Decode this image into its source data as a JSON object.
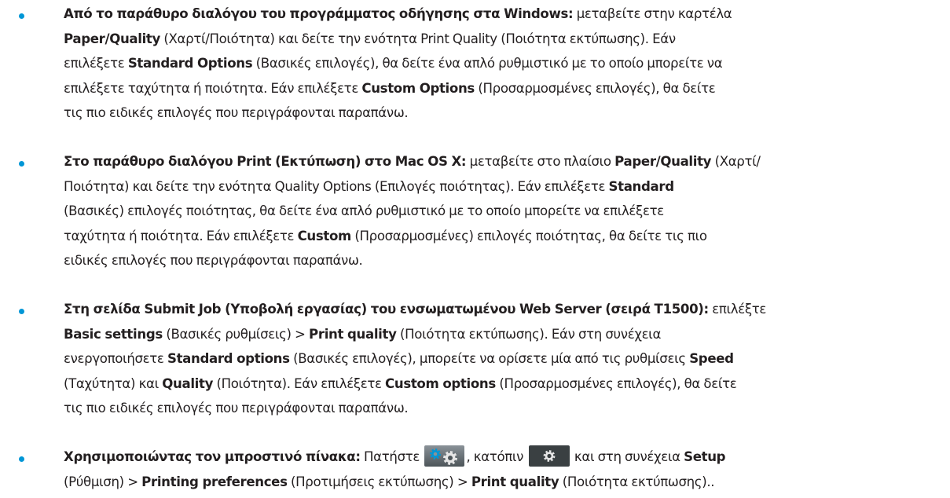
{
  "bullet_color": "#0096d6",
  "button_colors": {
    "settings_bg_top": "#8a9298",
    "settings_bg_bottom": "#4d5559",
    "setup_bg": "#3a4042",
    "icon_blue": "#0096d6",
    "icon_light": "#e6e6e6"
  },
  "icons": [
    "settings-gears-icon",
    "setup-gear-icon"
  ],
  "bullets": [
    {
      "lines": [
        [
          {
            "t": "Από το παράθυρο διαλόγου του προγράμματος οδήγησης στα Windows:",
            "b": true
          },
          {
            "t": " μεταβείτε στην καρτέλα"
          }
        ],
        [
          {
            "t": "Paper/Quality",
            "b": true
          },
          {
            "t": " (Χαρτί/Ποιότητα) και δείτε την ενότητα Print Quality (Ποιότητα εκτύπωσης). Εάν"
          }
        ],
        [
          {
            "t": "επιλέξετε "
          },
          {
            "t": "Standard Options",
            "b": true
          },
          {
            "t": " (Βασικές επιλογές), θα δείτε ένα απλό ρυθμιστικό με το οποίο μπορείτε να"
          }
        ],
        [
          {
            "t": "επιλέξετε ταχύτητα ή ποιότητα. Εάν επιλέξετε "
          },
          {
            "t": "Custom Options",
            "b": true
          },
          {
            "t": " (Προσαρμοσμένες επιλογές), θα δείτε"
          }
        ],
        [
          {
            "t": "τις πιο ειδικές επιλογές που περιγράφονται παραπάνω."
          }
        ]
      ]
    },
    {
      "lines": [
        [
          {
            "t": "Στο παράθυρο διαλόγου Print (Εκτύπωση) στο Mac OS X:",
            "b": true
          },
          {
            "t": " μεταβείτε στο πλαίσιο "
          },
          {
            "t": "Paper/Quality",
            "b": true
          },
          {
            "t": " (Χαρτί/"
          }
        ],
        [
          {
            "t": "Ποιότητα) και δείτε την ενότητα Quality Options (Επιλογές ποιότητας). Εάν επιλέξετε "
          },
          {
            "t": "Standard",
            "b": true
          }
        ],
        [
          {
            "t": "(Βασικές) επιλογές ποιότητας, θα δείτε ένα απλό ρυθμιστικό με το οποίο μπορείτε να επιλέξετε"
          }
        ],
        [
          {
            "t": "ταχύτητα ή ποιότητα. Εάν επιλέξετε "
          },
          {
            "t": "Custom",
            "b": true
          },
          {
            "t": " (Προσαρμοσμένες) επιλογές ποιότητας, θα δείτε τις πιο"
          }
        ],
        [
          {
            "t": "ειδικές επιλογές που περιγράφονται παραπάνω."
          }
        ]
      ]
    },
    {
      "lines": [
        [
          {
            "t": "Στη σελίδα Submit Job (Υποβολή εργασίας) του ενσωματωμένου Web Server (σειρά T1500):",
            "b": true
          },
          {
            "t": " επιλέξτε"
          }
        ],
        [
          {
            "t": "Basic settings",
            "b": true
          },
          {
            "t": " (Βασικές ρυθμίσεις) > "
          },
          {
            "t": "Print quality",
            "b": true
          },
          {
            "t": " (Ποιότητα εκτύπωσης). Εάν στη συνέχεια"
          }
        ],
        [
          {
            "t": "ενεργοποιήσετε "
          },
          {
            "t": "Standard options",
            "b": true
          },
          {
            "t": " (Βασικές επιλογές), μπορείτε να ορίσετε μία από τις ρυθμίσεις "
          },
          {
            "t": "Speed",
            "b": true
          }
        ],
        [
          {
            "t": "(Ταχύτητα) και "
          },
          {
            "t": "Quality",
            "b": true
          },
          {
            "t": " (Ποιότητα). Εάν επιλέξετε "
          },
          {
            "t": "Custom options",
            "b": true
          },
          {
            "t": " (Προσαρμοσμένες επιλογές), θα δείτε"
          }
        ],
        [
          {
            "t": "τις πιο ειδικές επιλογές που περιγράφονται παραπάνω."
          }
        ]
      ]
    },
    {
      "lines": [
        [
          {
            "t": "Χρησιμοποιώντας τον μπροστινό πίνακα:",
            "b": true
          },
          {
            "t": " Πατήστε "
          },
          {
            "icon": "settings-gears-icon"
          },
          {
            "t": ", κατόπιν "
          },
          {
            "icon": "setup-gear-icon"
          },
          {
            "t": " και στη συνέχεια "
          },
          {
            "t": "Setup",
            "b": true
          }
        ],
        [
          {
            "t": "(Ρύθμιση) > "
          },
          {
            "t": "Printing preferences",
            "b": true
          },
          {
            "t": " (Προτιμήσεις εκτύπωσης) > "
          },
          {
            "t": "Print quality",
            "b": true
          },
          {
            "t": " (Ποιότητα εκτύπωσης).."
          }
        ]
      ]
    }
  ]
}
